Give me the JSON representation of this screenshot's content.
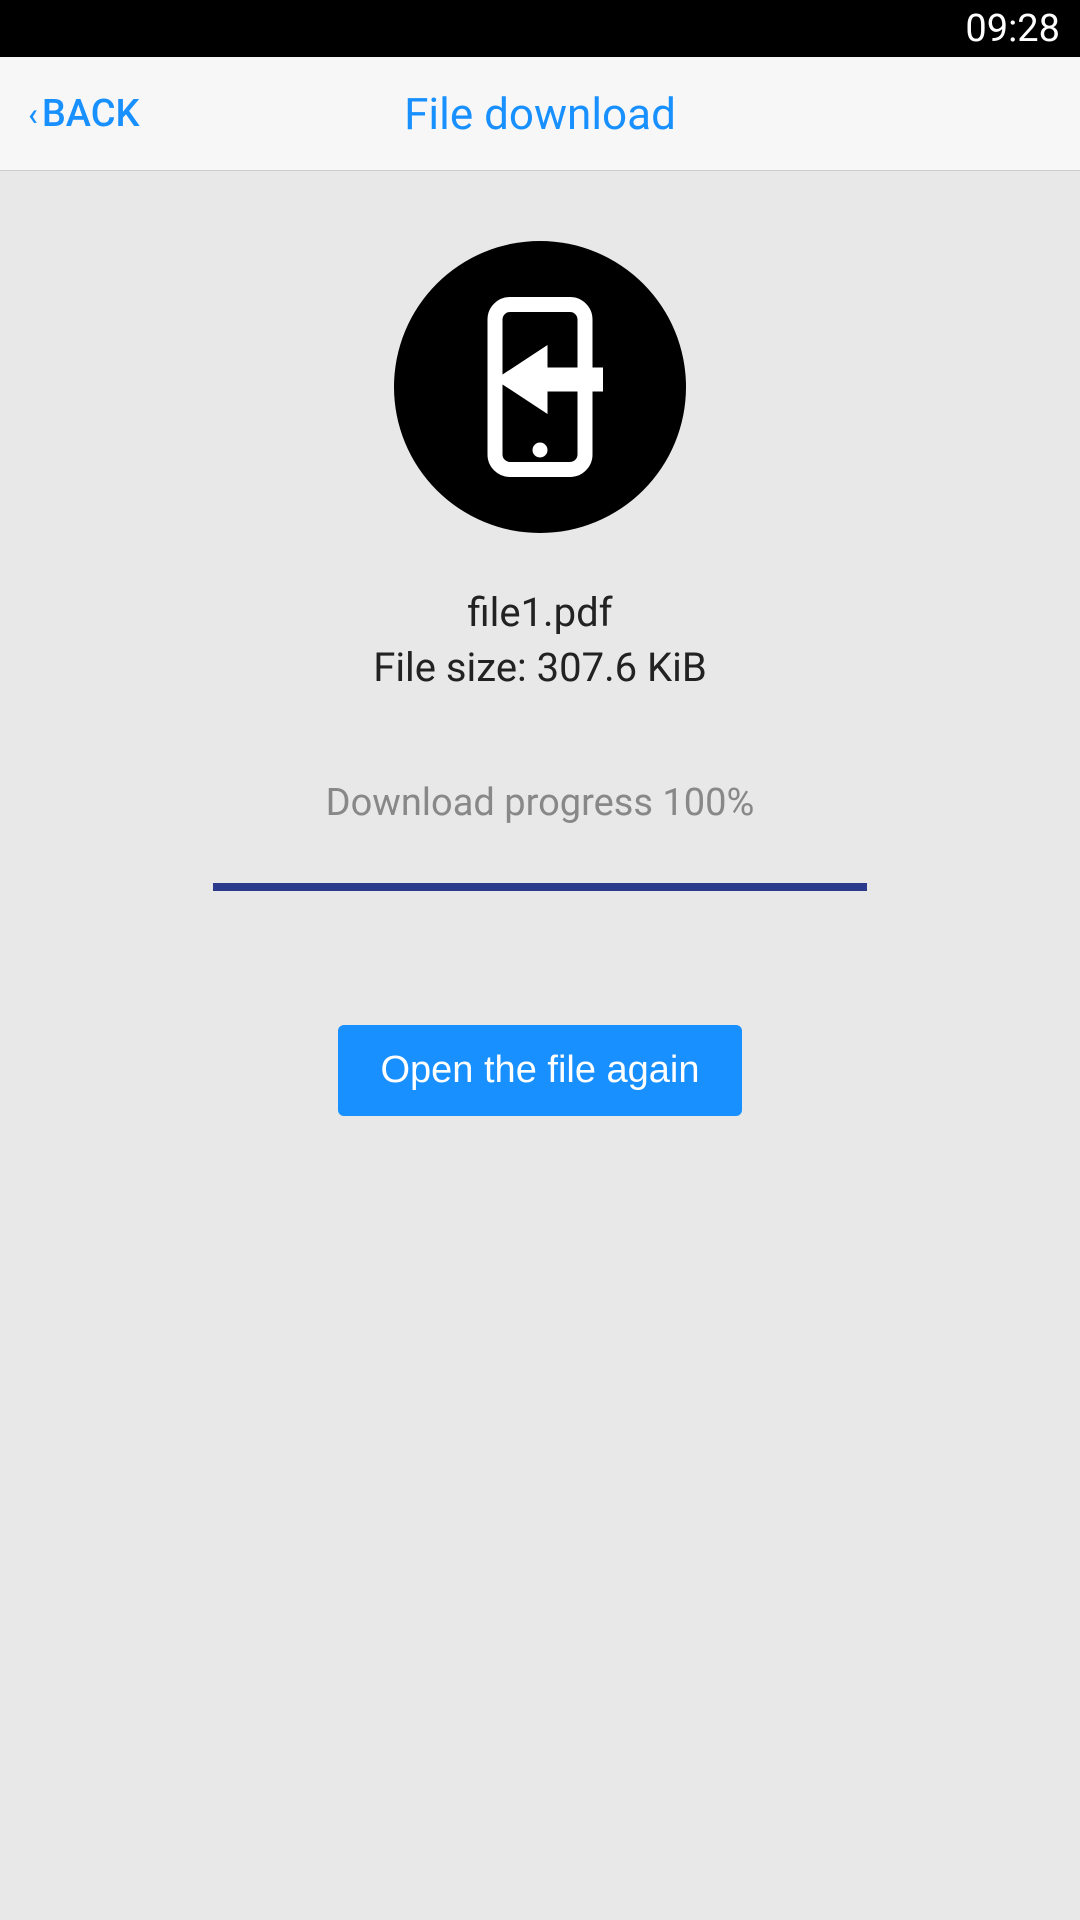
{
  "statusBar": {
    "time": "09:28"
  },
  "header": {
    "backLabel": "BACK",
    "title": "File download"
  },
  "file": {
    "name": "file1.pdf",
    "sizeLabel": "File size: 307.6 KiB"
  },
  "progress": {
    "label": "Download progress 100%",
    "percent": 100
  },
  "actions": {
    "openAgainLabel": "Open the file again"
  },
  "colors": {
    "accent": "#1890ff",
    "progressBar": "#2b3a8b"
  }
}
